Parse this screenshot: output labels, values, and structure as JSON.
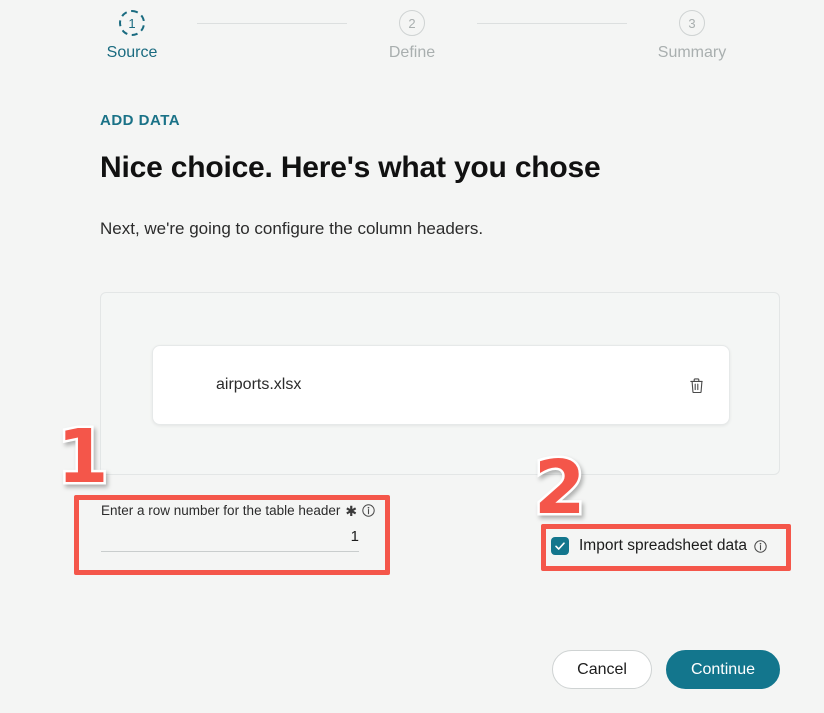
{
  "stepper": {
    "steps": [
      {
        "number": "1",
        "label": "Source",
        "state": "active"
      },
      {
        "number": "2",
        "label": "Define",
        "state": "inactive"
      },
      {
        "number": "3",
        "label": "Summary",
        "state": "inactive"
      }
    ]
  },
  "content": {
    "eyebrow": "ADD DATA",
    "headline": "Nice choice. Here's what you chose",
    "subhead": "Next, we're going to configure the column headers."
  },
  "dropzone": {
    "file": {
      "name": "airports.xlsx",
      "delete_icon": "trash-icon"
    }
  },
  "row_field": {
    "label": "Enter a row number for the table header",
    "required_marker": "✱",
    "info_icon": "info-icon",
    "value": "1",
    "placeholder": ""
  },
  "import_checkbox": {
    "label": "Import spreadsheet data",
    "checked": true,
    "info_icon": "info-icon"
  },
  "footer": {
    "cancel_label": "Cancel",
    "continue_label": "Continue"
  },
  "annotations": [
    {
      "number": "1",
      "target": "row-number-field"
    },
    {
      "number": "2",
      "target": "import-spreadsheet-checkbox"
    }
  ],
  "colors": {
    "accent_teal": "#13768d",
    "eyebrow_teal": "#1a7287",
    "annotation_red": "#f4564a",
    "page_background": "#f4f5f4",
    "dropzone_background": "#f4f6f5"
  }
}
